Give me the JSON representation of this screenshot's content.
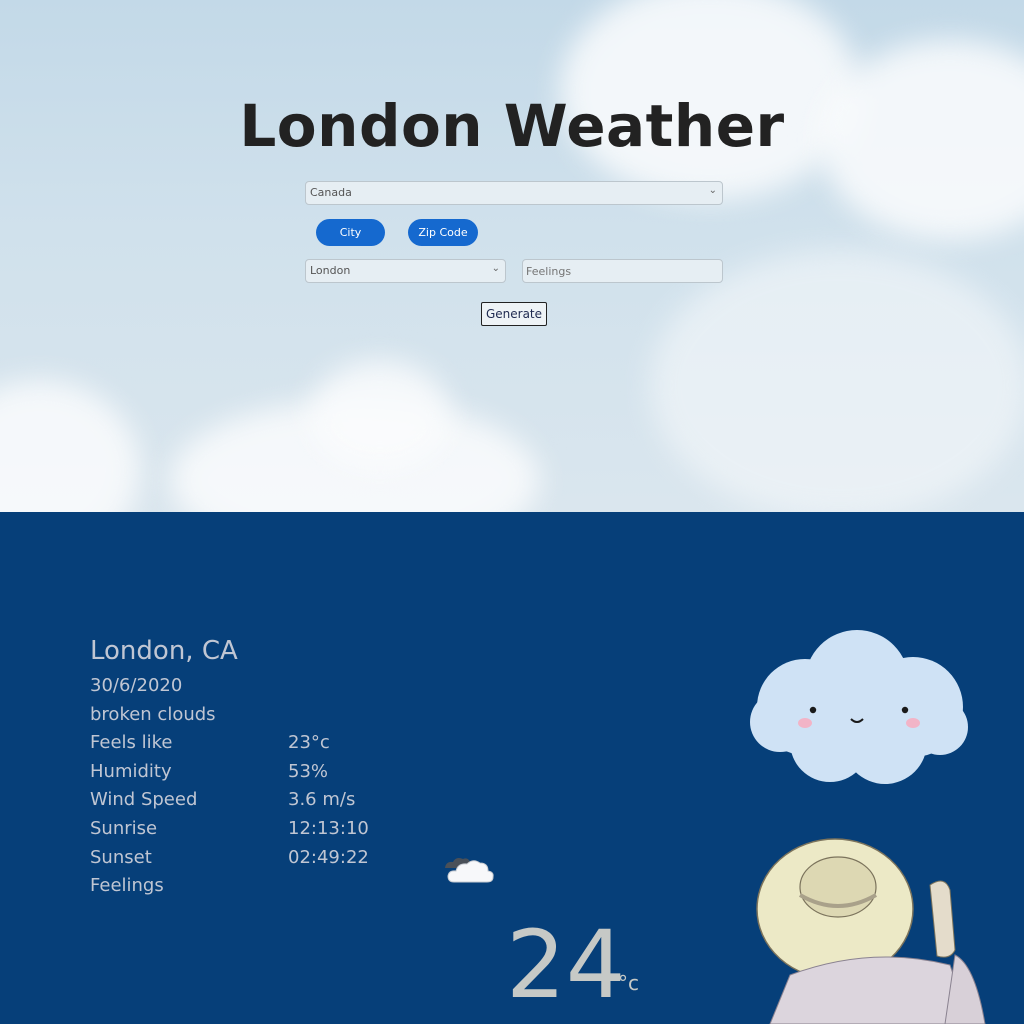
{
  "header": {
    "title": "London Weather"
  },
  "form": {
    "country_value": "Canada",
    "toggle_city_label": "City",
    "toggle_zip_label": "Zip Code",
    "city_value": "London",
    "feelings_placeholder": "Feelings",
    "generate_label": "Generate"
  },
  "weather": {
    "location": "London, CA",
    "date": "30/6/2020",
    "description": "broken clouds",
    "details": [
      {
        "label": "Feels like",
        "value": "23°c"
      },
      {
        "label": "Humidity",
        "value": "53%"
      },
      {
        "label": "Wind Speed",
        "value": "3.6 m/s"
      },
      {
        "label": "Sunrise",
        "value": "12:13:10"
      },
      {
        "label": "Sunset",
        "value": "02:49:22"
      }
    ],
    "feelings_label": "Feelings",
    "temperature": "24",
    "unit": "°c",
    "icon": "broken-clouds-icon"
  },
  "colors": {
    "sky": "#c3d9e8",
    "panel": "#063f79",
    "accent_button": "#1569cf",
    "text_light": "#c0c6d3"
  }
}
